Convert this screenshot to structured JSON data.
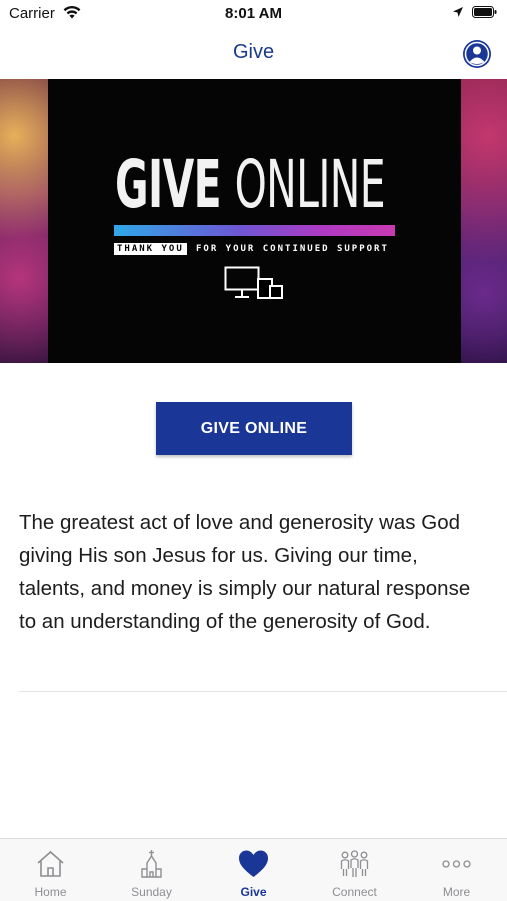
{
  "status_bar": {
    "carrier": "Carrier",
    "time": "8:01 AM"
  },
  "nav": {
    "title": "Give"
  },
  "banner": {
    "headline_bold": "GIVE",
    "headline_light": "ONLINE",
    "thank_you": "THANK YOU",
    "support": "FOR YOUR CONTINUED SUPPORT"
  },
  "give_button": {
    "label": "GIVE ONLINE"
  },
  "content": {
    "body": "The greatest act of love and generosity was God giving His son Jesus for us. Giving our time, talents, and money is simply our natural response to an understanding of the generosity of God."
  },
  "tabs": [
    {
      "label": "Home",
      "icon": "home-icon"
    },
    {
      "label": "Sunday",
      "icon": "church-icon"
    },
    {
      "label": "Give",
      "icon": "heart-icon",
      "active": true
    },
    {
      "label": "Connect",
      "icon": "people-icon"
    },
    {
      "label": "More",
      "icon": "more-dots-icon"
    }
  ],
  "colors": {
    "brand": "#1a3798",
    "nav_title": "#1a3a8c",
    "tab_inactive": "#8e8e93"
  }
}
